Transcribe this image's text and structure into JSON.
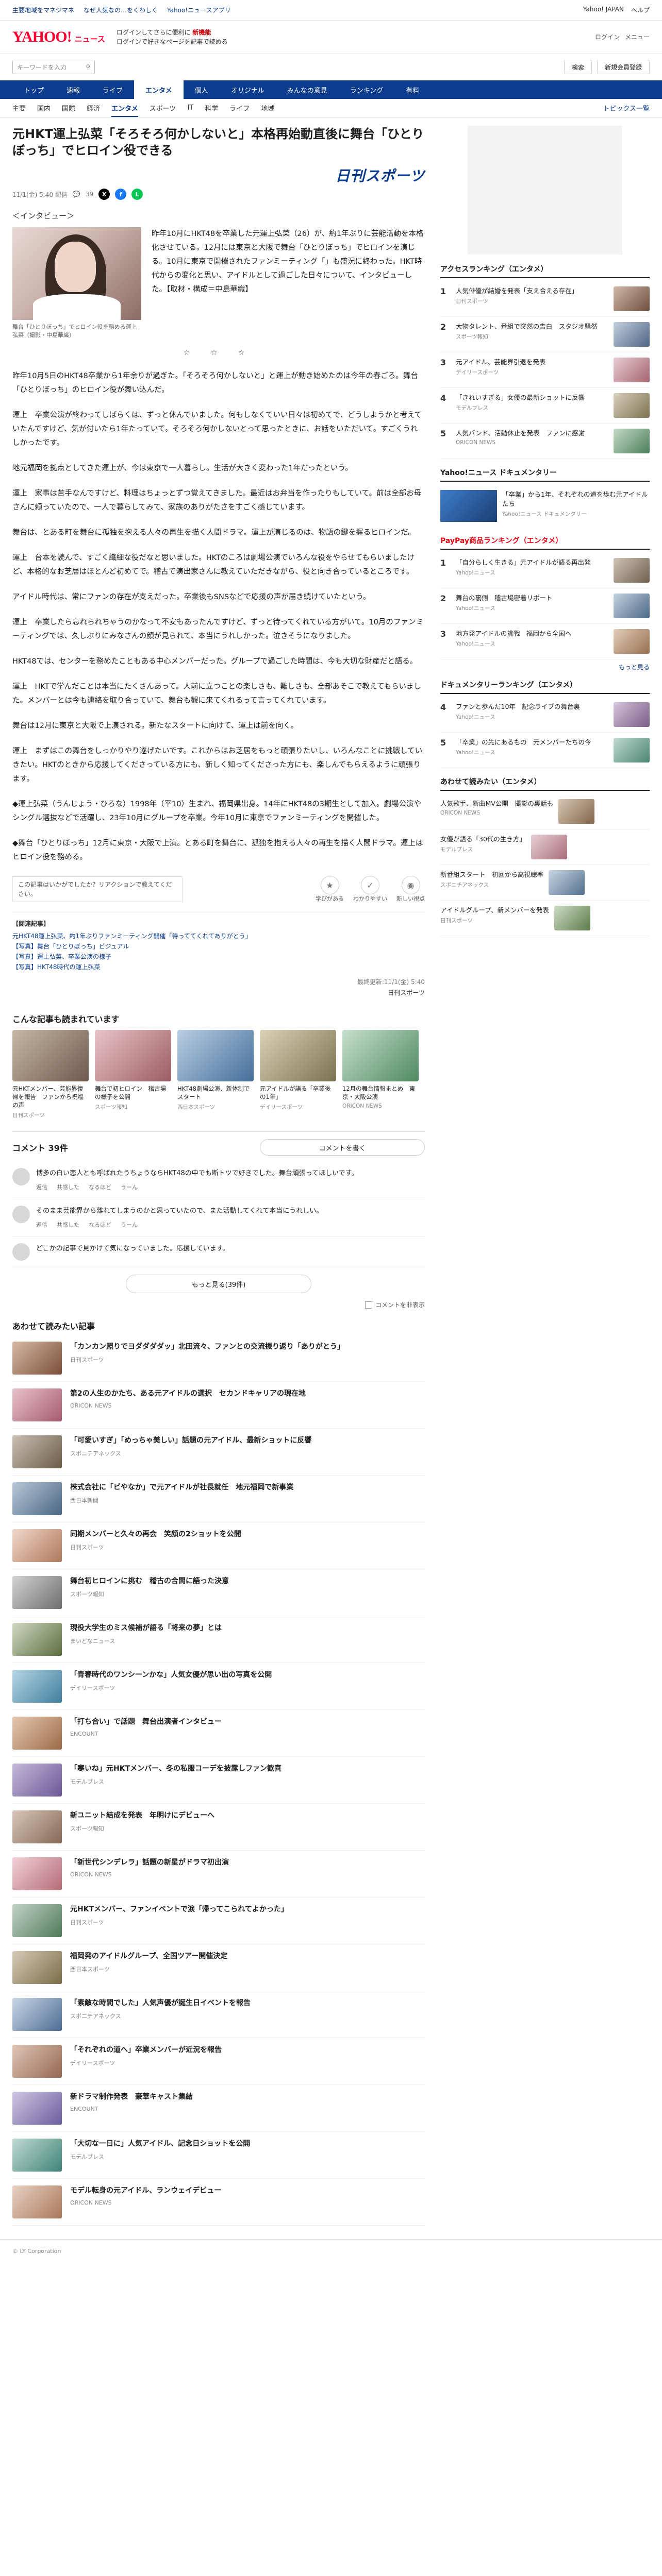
{
  "topstrip": {
    "promo": [
      "主要地域をマネジマネ",
      "なぜ人気なの…をくわしく",
      "Yahoo!ニュースアプリ"
    ],
    "links": [
      "Yahoo! JAPAN",
      "ヘルプ"
    ]
  },
  "header": {
    "logo_main": "YAHOO!",
    "logo_sub": "ニュース",
    "msg_line1": "ログインしてさらに便利に",
    "msg_red": "新機能",
    "msg_line2": "ログインで好きなページを記事で読める",
    "right": [
      "ログイン",
      "メニュー"
    ]
  },
  "search": {
    "placeholder": "キーワードを入力",
    "button": "検索",
    "login": "新規会員登録"
  },
  "mainnav": [
    "トップ",
    "速報",
    "ライブ",
    "個人",
    "オリジナル",
    "みんなの意見",
    "ランキング",
    "有料"
  ],
  "mainnav_active": "エンタメ",
  "subnav": [
    "主要",
    "国内",
    "国際",
    "経済",
    "エンタメ",
    "スポーツ",
    "IT",
    "科学",
    "ライフ",
    "地域"
  ],
  "subnav_active": "エンタメ",
  "subnav_right": "トピックス一覧",
  "article": {
    "title": "元HKT運上弘菜「そろそろ何かしないと」本格再始動直後に舞台「ひとりぼっち」でヒロイン役できる",
    "brand": "日刊スポーツ",
    "date": "11/1(金) 5:40 配信",
    "comment_count": "39",
    "kicker": "＜インタビュー＞",
    "lead_paragraph": "昨年10月にHKT48を卒業した元運上弘菜（26）が、約1年ぶりに芸能活動を本格化させている。12月には東京と大阪で舞台「ひとりぼっち」でヒロインを演じる。10月に東京で開催されたファンミーティング「」も盛況に終わった。HKT時代からの変化と思い、アイドルとして過ごした日々について、インタビューした。【取材・構成＝中島華織】",
    "photo_caption": "舞台「ひとりぼっち」でヒロイン役を務める運上弘菜（撮影・中島華織）",
    "stars": "☆ ☆ ☆",
    "paragraphs": [
      "昨年10月5日のHKT48卒業から1年余りが過ぎた。「そろそろ何かしないと」と運上が動き始めたのは今年の春ごろ。舞台「ひとりぼっち」のヒロイン役が舞い込んだ。",
      "運上　卒業公演が終わってしばらくは、ずっと休んでいました。何もしなくていい日々は初めてで、どうしようかと考えていたんですけど、気が付いたら1年たっていて。そろそろ何かしないとって思ったときに、お話をいただいて。すごくうれしかったです。",
      "地元福岡を拠点としてきた運上が、今は東京で一人暮らし。生活が大きく変わった1年だったという。",
      "運上　家事は苦手なんですけど、料理はちょっとずつ覚えてきました。最近はお弁当を作ったりもしていて。前は全部お母さんに頼っていたので、一人で暮らしてみて、家族のありがたさをすごく感じています。",
      "舞台は、とある町を舞台に孤独を抱える人々の再生を描く人間ドラマ。運上が演じるのは、物語の鍵を握るヒロインだ。",
      "運上　台本を読んで、すごく繊細な役だなと思いました。HKTのころは劇場公演でいろんな役をやらせてもらいましたけど、本格的なお芝居はほとんど初めてで。稽古で演出家さんに教えていただきながら、役と向き合っているところです。",
      "アイドル時代は、常にファンの存在が支えだった。卒業後もSNSなどで応援の声が届き続けていたという。",
      "運上　卒業したら忘れられちゃうのかなって不安もあったんですけど、ずっと待ってくれている方がいて。10月のファンミーティングでは、久しぶりにみなさんの顔が見られて、本当にうれしかった。泣きそうになりました。",
      "HKT48では、センターを務めたこともある中心メンバーだった。グループで過ごした時間は、今も大切な財産だと語る。",
      "運上　HKTで学んだことは本当にたくさんあって。人前に立つことの楽しさも、難しさも、全部あそこで教えてもらいました。メンバーとは今も連絡を取り合っていて、舞台も観に来てくれるって言ってくれています。",
      "舞台は12月に東京と大阪で上演される。新たなスタートに向けて、運上は前を向く。",
      "運上　まずはこの舞台をしっかりやり遂げたいです。これからはお芝居をもっと頑張りたいし、いろんなことに挑戦していきたい。HKTのときから応援してくださっている方にも、新しく知ってくださった方にも、楽しんでもらえるように頑張ります。",
      "◆運上弘菜（うんじょう・ひろな）1998年（平10）生まれ、福岡県出身。14年にHKT48の3期生として加入。劇場公演やシングル選抜などで活躍し、23年10月にグループを卒業。今年10月に東京でファンミーティングを開催した。",
      "◆舞台「ひとりぼっち」12月に東京・大阪で上演。とある町を舞台に、孤独を抱える人々の再生を描く人間ドラマ。運上はヒロイン役を務める。"
    ],
    "quiz": "この記事はいかがでしたか？リアクションで教えてください。",
    "reactions": [
      "学びがある",
      "わかりやすい",
      "新しい視点"
    ],
    "related_head": "【関連記事】",
    "related_links": [
      "元HKT48運上弘菜、約1年ぶりファンミーティング開催「待っててくれてありがとう」",
      "【写真】舞台「ひとりぼっち」ビジュアル",
      "【写真】運上弘菜、卒業公演の様子",
      "【写真】HKT48時代の運上弘菜"
    ],
    "source_line": "最終更新:11/1(金) 5:40",
    "source_name": "日刊スポーツ"
  },
  "photo_strip": {
    "title": "こんな記事も読まれています",
    "cards": [
      {
        "tx": "元HKTメンバー、芸能界復帰を報告　ファンから祝福の声",
        "src": "日刊スポーツ",
        "c1": "#c7b7a7",
        "c2": "#6f5a4d"
      },
      {
        "tx": "舞台で初ヒロイン　稽古場の様子を公開",
        "src": "スポーツ報知",
        "c1": "#e9c4c7",
        "c2": "#9b5d63"
      },
      {
        "tx": "HKT48劇場公演、新体制でスタート",
        "src": "西日本スポーツ",
        "c1": "#b9cfe3",
        "c2": "#456f9b"
      },
      {
        "tx": "元アイドルが語る「卒業後の1年」",
        "src": "デイリースポーツ",
        "c1": "#d9d2b6",
        "c2": "#7d7350"
      },
      {
        "tx": "12月の舞台情報まとめ　東京・大阪公演",
        "src": "ORICON NEWS",
        "c1": "#c6e0cd",
        "c2": "#4f8a61"
      }
    ]
  },
  "comments": {
    "title": "コメント 39件",
    "write_btn": "コメントを書く",
    "items": [
      "博多の白い恋人とも呼ばれたうちょうならHKT48の中でも断トツで好きでした。舞台頑張ってほしいです。",
      "そのまま芸能界から離れてしまうのかと思っていたので、また活動してくれて本当にうれしい。",
      "どこかの記事で見かけて気になっていました。応援しています。"
    ],
    "tools": [
      "返信",
      "共感した",
      "なるほど",
      "うーん"
    ],
    "more_btn": "もっと見る(39件)",
    "hide_label": "コメントを非表示"
  },
  "list": {
    "title": "あわせて読みたい記事",
    "items": [
      {
        "tx": "「カンカン照りでヨダダダダッ」北田流々、ファンとの交流振り返り「ありがとう」",
        "src": "日刊スポーツ",
        "c1": "#d7b9a3",
        "c2": "#7a4f3a"
      },
      {
        "tx": "第2の人生のかたち、ある元アイドルの選択　セカンドキャリアの現在地",
        "src": "ORICON NEWS",
        "c1": "#e7c1ca",
        "c2": "#a65d6e"
      },
      {
        "tx": "「可愛いすぎ」「めっちゃ美しい」話題の元アイドル、最新ショットに反響",
        "src": "スポニチアネックス",
        "c1": "#c9c0b3",
        "c2": "#6b5c47"
      },
      {
        "tx": "株式会社に「ビやなか」で元アイドルが社長就任　地元福岡で新事業",
        "src": "西日本新聞",
        "c1": "#b8c8d8",
        "c2": "#4a6783"
      },
      {
        "tx": "同期メンバーと久々の再会　笑顔の2ショットを公開",
        "src": "日刊スポーツ",
        "c1": "#f0d7c9",
        "c2": "#b07a5d"
      },
      {
        "tx": "舞台初ヒロインに挑む　稽古の合間に語った決意",
        "src": "スポーツ報知",
        "c1": "#d3d3d3",
        "c2": "#6e6e6e"
      },
      {
        "tx": "現役大学生のミス候補が語る「将来の夢」とは",
        "src": "まいどなニュース",
        "c1": "#cfd8c0",
        "c2": "#5c6f40"
      },
      {
        "tx": "「青春時代のワンシーンかな」人気女優が思い出の写真を公開",
        "src": "デイリースポーツ",
        "c1": "#b7d7e6",
        "c2": "#3f7f9c"
      },
      {
        "tx": "「打ち合い」で話題　舞台出演者インタビュー",
        "src": "ENCOUNT",
        "c1": "#e5c8b0",
        "c2": "#9c6b48"
      },
      {
        "tx": "「寒いね」元HKTメンバー、冬の私服コーデを披露しファン歓喜",
        "src": "モデルプレス",
        "c1": "#c5b9d9",
        "c2": "#6a5896"
      },
      {
        "tx": "新ユニット結成を発表　年明けにデビューへ",
        "src": "スポーツ報知",
        "c1": "#d8c5b8",
        "c2": "#856a56"
      },
      {
        "tx": "「新世代シンデレラ」話題の新星がドラマ初出演",
        "src": "ORICON NEWS",
        "c1": "#f1d1d6",
        "c2": "#b46b77"
      },
      {
        "tx": "元HKTメンバー、ファンイベントで涙「帰ってこられてよかった」",
        "src": "日刊スポーツ",
        "c1": "#c2d3c6",
        "c2": "#4f7a5a"
      },
      {
        "tx": "福岡発のアイドルグループ、全国ツアー開催決定",
        "src": "西日本スポーツ",
        "c1": "#d5cbb6",
        "c2": "#7c6d48"
      },
      {
        "tx": "「素敵な時間でした」人気声優が誕生日イベントを報告",
        "src": "スポニチアネックス",
        "c1": "#c9d6e5",
        "c2": "#4d6e94"
      },
      {
        "tx": "「それぞれの道へ」卒業メンバーが近況を報告",
        "src": "デイリースポーツ",
        "c1": "#e0c6b7",
        "c2": "#946851"
      },
      {
        "tx": "新ドラマ制作発表　豪華キャスト集結",
        "src": "ENCOUNT",
        "c1": "#cfc7e1",
        "c2": "#6c5d9e"
      },
      {
        "tx": "「大切な一日に」人気アイドル、記念日ショットを公開",
        "src": "モデルプレス",
        "c1": "#bfd9d2",
        "c2": "#3f8577"
      },
      {
        "tx": "モデル転身の元アイドル、ランウェイデビュー",
        "src": "ORICON NEWS",
        "c1": "#e8d2c3",
        "c2": "#a9775a"
      }
    ]
  },
  "sidebar": {
    "access_title": "アクセスランキング（エンタメ）",
    "access": [
      {
        "n": "1",
        "tx": "人気俳優が結婚を発表「支え合える存在」",
        "src": "日刊スポーツ",
        "c1": "#d0b8a8",
        "c2": "#6e4f3d"
      },
      {
        "n": "2",
        "tx": "大物タレント、番組で突然の告白　スタジオ騒然",
        "src": "スポーツ報知",
        "c1": "#c4cfdc",
        "c2": "#4c6484"
      },
      {
        "n": "3",
        "tx": "元アイドル、芸能界引退を発表",
        "src": "デイリースポーツ",
        "c1": "#e6cdd1",
        "c2": "#a5646f"
      },
      {
        "n": "4",
        "tx": "「きれいすぎる」女優の最新ショットに反響",
        "src": "モデルプレス",
        "c1": "#d8d1bd",
        "c2": "#7d7250"
      },
      {
        "n": "5",
        "tx": "人気バンド、活動休止を発表　ファンに感謝",
        "src": "ORICON NEWS",
        "c1": "#c3d9c8",
        "c2": "#4c7f5a"
      }
    ],
    "doc_title": "Yahoo!ニュース ドキュメンタリー",
    "doc_text": "「卒業」から1年、それぞれの道を歩む元アイドルたち",
    "doc_src": "Yahoo!ニュース ドキュメンタリー",
    "paypay_title": "PayPay商品ランキング（エンタメ）",
    "topics_title": "ドキュメンタリーランキング（エンタメ）",
    "extra": [
      {
        "n": "1",
        "tx": "「自分らしく生きる」元アイドルが語る再出発",
        "src": "Yahoo!ニュース",
        "c1": "#cfc3b6",
        "c2": "#6e5f4e"
      },
      {
        "n": "2",
        "tx": "舞台の裏側　稽古場密着リポート",
        "src": "Yahoo!ニュース",
        "c1": "#c5d2e0",
        "c2": "#4b6888"
      },
      {
        "n": "3",
        "tx": "地方発アイドルの挑戦　福岡から全国へ",
        "src": "Yahoo!ニュース",
        "c1": "#e2cdb9",
        "c2": "#97704f"
      },
      {
        "n": "4",
        "tx": "ファンと歩んだ10年　記念ライブの舞台裏",
        "src": "Yahoo!ニュース",
        "c1": "#d6c4dc",
        "c2": "#7b5c86"
      },
      {
        "n": "5",
        "tx": "「卒業」の先にあるもの　元メンバーたちの今",
        "src": "Yahoo!ニュース",
        "c1": "#c1dad0",
        "c2": "#4a8570"
      }
    ],
    "more": "もっと見る",
    "osusume_title": "あわせて読みたい（エンタメ）",
    "osusume": [
      {
        "tx": "人気歌手、新曲MV公開　撮影の裏話も",
        "src": "ORICON NEWS",
        "c1": "#d9c7b4",
        "c2": "#7f6449"
      },
      {
        "tx": "女優が語る「30代の生き方」",
        "src": "モデルプレス",
        "c1": "#e8d0d5",
        "c2": "#a86e7a"
      },
      {
        "tx": "新番組スタート　初回から高視聴率",
        "src": "スポニチアネックス",
        "c1": "#c8d5e2",
        "c2": "#53708f"
      },
      {
        "tx": "アイドルグループ、新メンバーを発表",
        "src": "日刊スポーツ",
        "c1": "#cfdcc6",
        "c2": "#5a7a48"
      }
    ]
  },
  "footer": "© LY Corporation"
}
